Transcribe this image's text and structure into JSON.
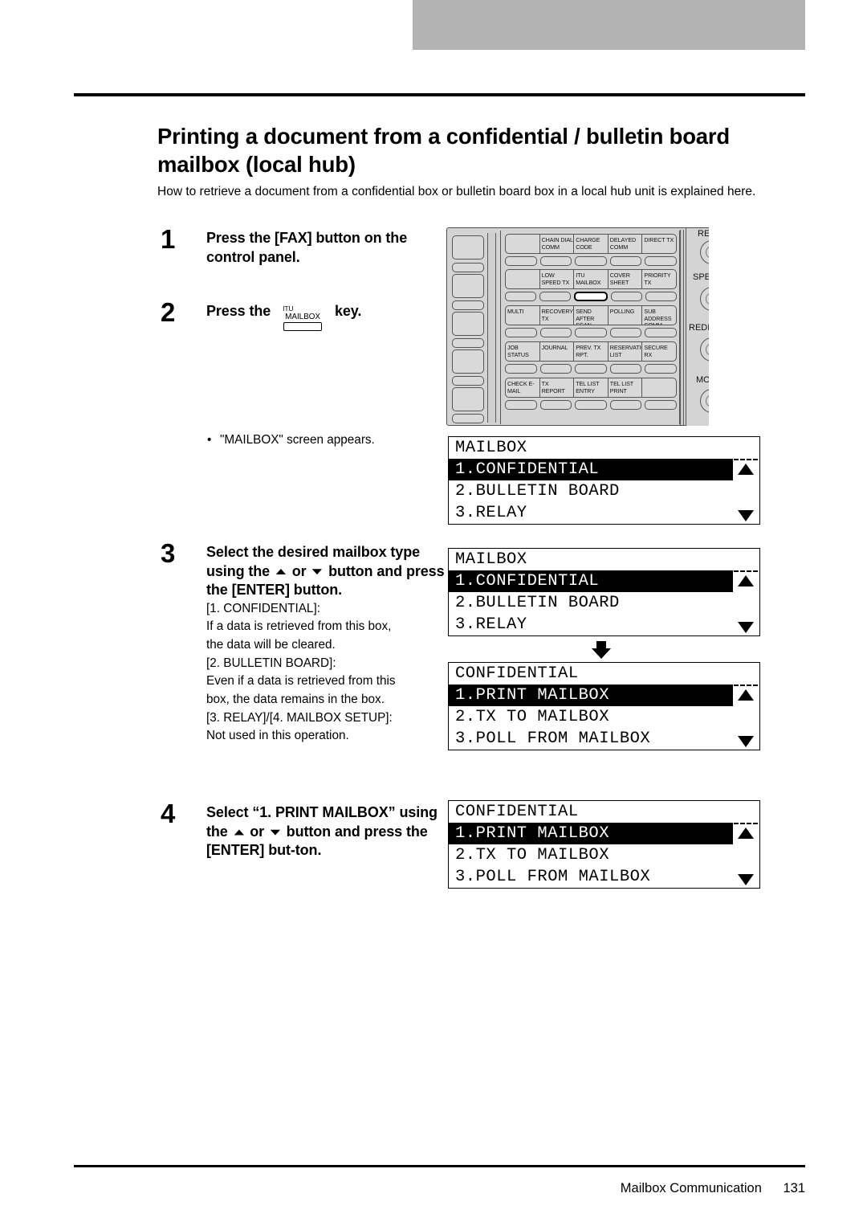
{
  "page": {
    "title": "Printing a document from a confidential / bulletin board mailbox (local hub)",
    "intro": "How to retrieve a document from a confidential box or bulletin board box in a local hub unit is explained here."
  },
  "steps": [
    {
      "number": "1",
      "heading": "Press the [FAX] button on the control panel.",
      "body": ""
    },
    {
      "number": "2",
      "heading_before": "Press the",
      "heading_after": "key.",
      "key_label_line1": "ITU",
      "key_label_line2": "MAILBOX"
    },
    {
      "number": "3",
      "heading_part1": "Select the desired mailbox type using the",
      "heading_or": "or",
      "heading_part2": "button and press the [ENTER] button.",
      "body_lines": [
        "[1. CONFIDENTIAL]:",
        "If a data is retrieved from this box,",
        "the data will be cleared.",
        "[2. BULLETIN BOARD]:",
        "Even if a data is retrieved from this",
        "box, the data remains in the box.",
        "[3. RELAY]/[4. MAILBOX SETUP]:",
        "Not used in this operation."
      ]
    },
    {
      "number": "4",
      "heading_part1": "Select “1. PRINT MAILBOX” using the",
      "heading_or": "or",
      "heading_part2": "button and press the [ENTER] but-ton."
    }
  ],
  "bullet_note": "\"MAILBOX\" screen appears.",
  "control_panel": {
    "label_rows": [
      [
        "",
        "CHAIN DIAL COMM",
        "CHARGE CODE",
        "DELAYED COMM",
        "DIRECT TX"
      ],
      [
        "",
        "LOW SPEED TX",
        "ITU MAILBOX",
        "COVER SHEET",
        "PRIORITY TX"
      ],
      [
        "MULTI",
        "RECOVERY TX",
        "SEND AFTER SCAN",
        "POLLING",
        "SUB ADDRESS COMM"
      ],
      [
        "JOB STATUS",
        "JOURNAL",
        "PREV. TX RPT.",
        "RESERVATION LIST",
        "SECURE RX"
      ],
      [
        "CHECK E-MAIL",
        "TX REPORT",
        "TEL LIST ENTRY",
        "TEL LIST PRINT",
        ""
      ]
    ],
    "selected_key": "ITU MAILBOX",
    "right_labels": [
      "RESO",
      "SPEED",
      "REDIAL",
      "MODE"
    ]
  },
  "lcd_screens": [
    {
      "id": "lcd1",
      "header": "MAILBOX",
      "items": [
        "1.CONFIDENTIAL",
        "2.BULLETIN BOARD",
        "3.RELAY"
      ],
      "highlighted_index": 0
    },
    {
      "id": "lcd2",
      "header": "MAILBOX",
      "items": [
        "1.CONFIDENTIAL",
        "2.BULLETIN BOARD",
        "3.RELAY"
      ],
      "highlighted_index": 0
    },
    {
      "id": "lcd3",
      "header": "CONFIDENTIAL",
      "items": [
        "1.PRINT MAILBOX",
        "2.TX TO MAILBOX",
        "3.POLL FROM MAILBOX"
      ],
      "highlighted_index": 0
    },
    {
      "id": "lcd4",
      "header": "CONFIDENTIAL",
      "items": [
        "1.PRINT MAILBOX",
        "2.TX TO MAILBOX",
        "3.POLL FROM MAILBOX"
      ],
      "highlighted_index": 0
    }
  ],
  "footer": {
    "section": "Mailbox Communication",
    "page_number": "131"
  },
  "colors": {
    "banner_gray": "#b3b3b3",
    "panel_gray": "#d4d4d4",
    "ink": "#000000"
  }
}
